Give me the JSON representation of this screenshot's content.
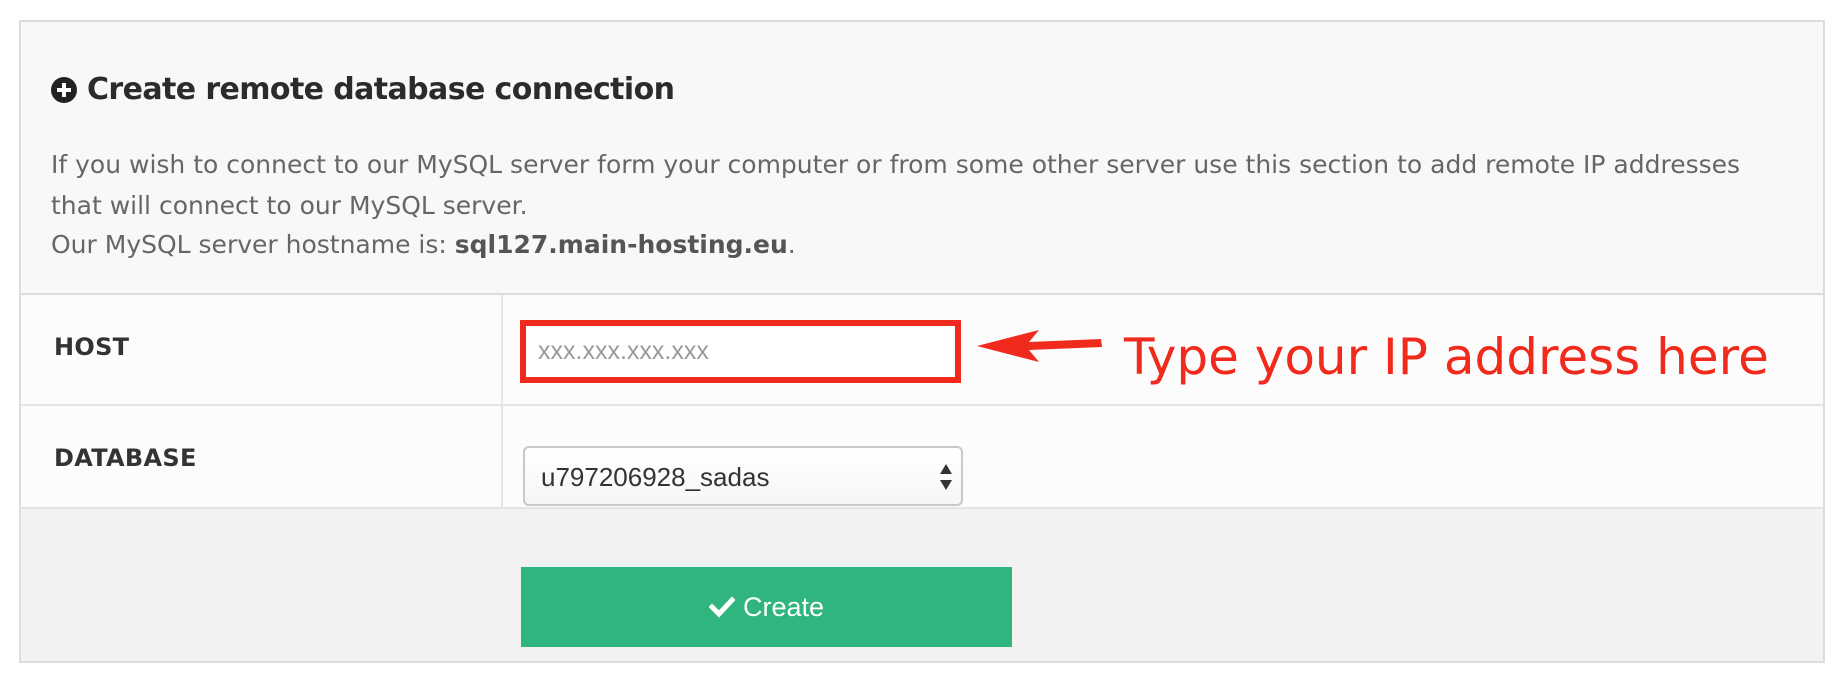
{
  "panel": {
    "title": "Create remote database connection",
    "description": "If you wish to connect to our MySQL server form your computer or from some other server use this section to add remote IP addresses that will connect to our MySQL server.",
    "hostname_prefix": "Our MySQL server hostname is: ",
    "hostname": "sql127.main-hosting.eu",
    "hostname_suffix": "."
  },
  "form": {
    "host_label": "HOST",
    "host_placeholder": "xxx.xxx.xxx.xxx",
    "host_value": "",
    "database_label": "DATABASE",
    "database_selected": "u797206928_sadas",
    "create_label": "Create"
  },
  "annotation": {
    "text": "Type your IP address here",
    "color": "#f02a1c"
  },
  "colors": {
    "create_button": "#2fb57d",
    "highlight": "#f02a1c"
  },
  "icons": {
    "title_icon": "plus-circle-icon",
    "button_icon": "check-icon",
    "select_icon": "select-arrows-icon"
  }
}
